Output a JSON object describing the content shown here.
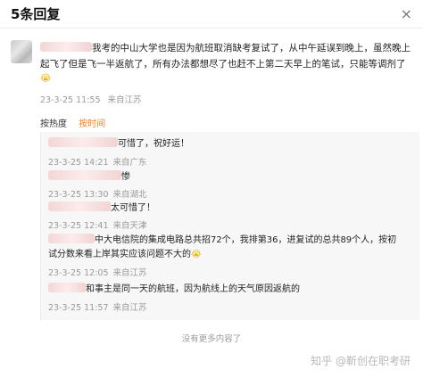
{
  "header": {
    "title": "5条回复",
    "close": "×"
  },
  "main_comment": {
    "text_line1": "我考的中山大学也是因为航班取消缺考复试了，从中午延误到晚上，虽然晚上",
    "text_line2": "起飞了但是飞一半返航了，所有办法都想尽了也赶不上第二天早上的笔试，只能等调剂了",
    "emoji": "😭",
    "date": "23-3-25",
    "time": "11:55",
    "from": "来自江苏"
  },
  "sort": {
    "hot": "按热度",
    "time": "按时间"
  },
  "replies": [
    {
      "text": "可惜了，祝好运！",
      "date": "23-3-25",
      "time": "14:21",
      "from": "来自广东"
    },
    {
      "text": "惨",
      "date": "23-3-25",
      "time": "13:30",
      "from": "来自湖北"
    },
    {
      "text": "太可惜了！",
      "date": "23-3-25",
      "time": "12:41",
      "from": "来自天津"
    },
    {
      "text_line1": "中大电信院的集成电路总共招72个，我排第36，进复试的总共89个人，按初",
      "text_line2": "试分数来看上岸其实应该问题不大的",
      "emoji": "😭",
      "date": "23-3-25",
      "time": "12:05",
      "from": "来自江苏"
    },
    {
      "text": "和事主是同一天的航班，因为航线上的天气原因返航的",
      "date": "23-3-25",
      "time": "11:57",
      "from": "来自江苏"
    }
  ],
  "footer": {
    "no_more": "没有更多内容了"
  },
  "watermark": "知乎 @靳创在职考研"
}
